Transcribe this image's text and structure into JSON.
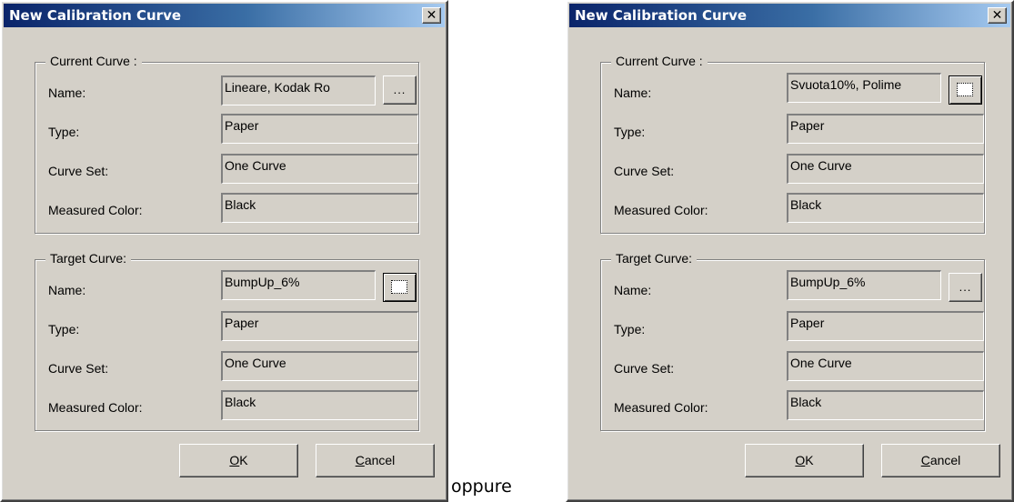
{
  "dialogs": [
    {
      "title": "New Calibration Curve",
      "current_curve": {
        "legend": "Current Curve :",
        "name_label": "Name:",
        "name_value": "Lineare, Kodak Ro",
        "type_label": "Type:",
        "type_value": "Paper",
        "curve_set_label": "Curve Set:",
        "curve_set_value": "One Curve",
        "measured_color_label": "Measured Color:",
        "measured_color_value": "Black",
        "browse_label": "...",
        "browse_focused": false
      },
      "target_curve": {
        "legend": "Target Curve:",
        "name_label": "Name:",
        "name_value": "BumpUp_6%",
        "type_label": "Type:",
        "type_value": "Paper",
        "curve_set_label": "Curve Set:",
        "curve_set_value": "One Curve",
        "measured_color_label": "Measured Color:",
        "measured_color_value": "Black",
        "browse_label": "",
        "browse_focused": true
      },
      "ok_mnemonic": "O",
      "ok_rest": "K",
      "cancel_mnemonic": "C",
      "cancel_rest": "ancel"
    },
    {
      "title": "New Calibration Curve",
      "current_curve": {
        "legend": "Current Curve :",
        "name_label": "Name:",
        "name_value": "Svuota10%, Polime",
        "type_label": "Type:",
        "type_value": "Paper",
        "curve_set_label": "Curve Set:",
        "curve_set_value": "One Curve",
        "measured_color_label": "Measured Color:",
        "measured_color_value": "Black",
        "browse_label": "",
        "browse_focused": true
      },
      "target_curve": {
        "legend": "Target Curve:",
        "name_label": "Name:",
        "name_value": "BumpUp_6%",
        "type_label": "Type:",
        "type_value": "Paper",
        "curve_set_label": "Curve Set:",
        "curve_set_value": "One Curve",
        "measured_color_label": "Measured Color:",
        "measured_color_value": "Black",
        "browse_label": "...",
        "browse_focused": false
      },
      "ok_mnemonic": "O",
      "ok_rest": "K",
      "cancel_mnemonic": "C",
      "cancel_rest": "ancel"
    }
  ],
  "between_text": "oppure",
  "colors": {
    "dialog_face": "#d4d0c8",
    "titlebar_start": "#0a246a",
    "titlebar_end": "#a6caf0"
  }
}
